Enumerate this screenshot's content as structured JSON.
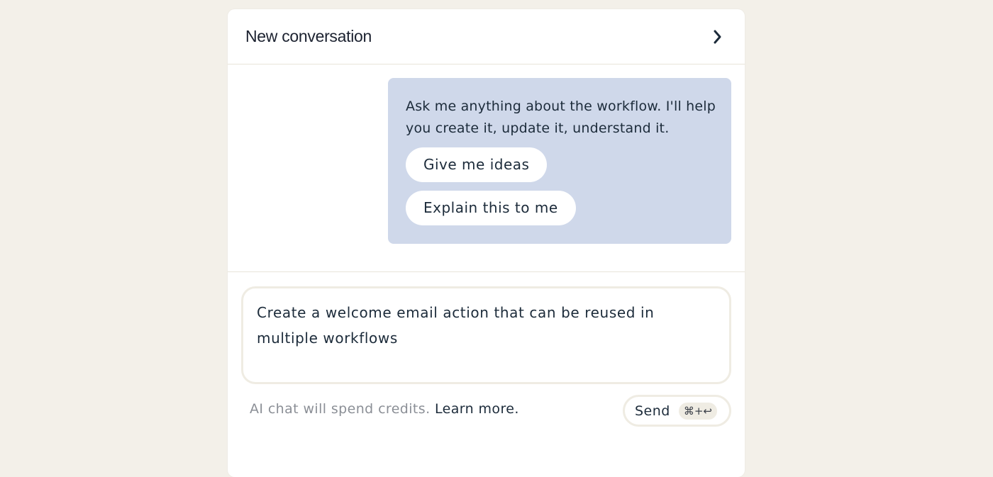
{
  "header": {
    "title": "New conversation",
    "collapse_icon": "chevron-right-icon"
  },
  "messages": [
    {
      "role": "assistant",
      "text": "Ask me anything about the workflow. I'll help you create it, update it, understand it.",
      "suggestions": [
        "Give me ideas",
        "Explain this to me"
      ]
    }
  ],
  "composer": {
    "value": "Create a welcome email action that can be reused in multiple workflows"
  },
  "footer": {
    "note": "AI chat will spend credits.",
    "learn_more": "Learn more.",
    "send_label": "Send",
    "shortcut": "⌘+↩"
  },
  "colors": {
    "background": "#f3f0e9",
    "bubble": "#cfd8ea",
    "text": "#1c2b3a"
  }
}
